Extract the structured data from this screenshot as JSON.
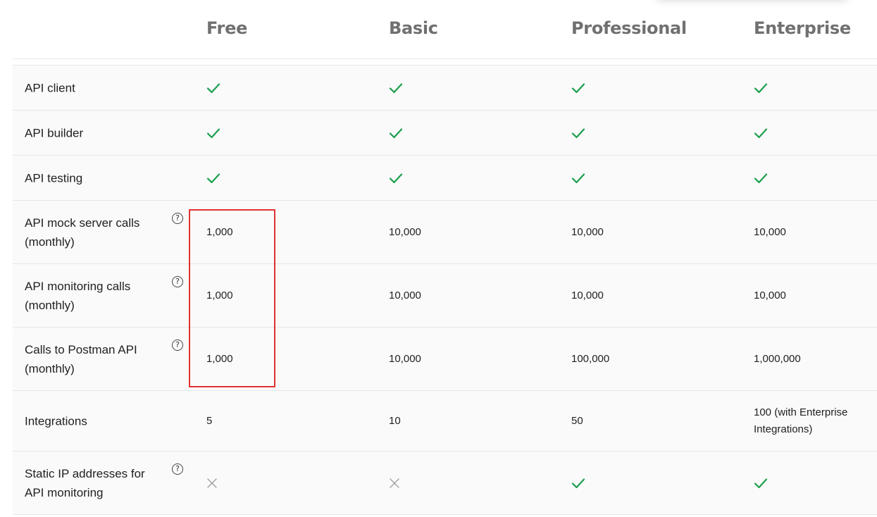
{
  "plans": [
    "Free",
    "Basic",
    "Professional",
    "Enterprise"
  ],
  "rows": [
    {
      "feature": "API client",
      "help": false,
      "values": [
        "check",
        "check",
        "check",
        "check"
      ]
    },
    {
      "feature": "API builder",
      "help": false,
      "values": [
        "check",
        "check",
        "check",
        "check"
      ]
    },
    {
      "feature": "API testing",
      "help": false,
      "values": [
        "check",
        "check",
        "check",
        "check"
      ]
    },
    {
      "feature": "API mock server calls (monthly)",
      "help": true,
      "values": [
        "1,000",
        "10,000",
        "10,000",
        "10,000"
      ]
    },
    {
      "feature": "API monitoring calls (monthly)",
      "help": true,
      "values": [
        "1,000",
        "10,000",
        "10,000",
        "10,000"
      ]
    },
    {
      "feature": "Calls to Postman API (monthly)",
      "help": true,
      "values": [
        "1,000",
        "10,000",
        "100,000",
        "1,000,000"
      ]
    },
    {
      "feature": "Integrations",
      "help": false,
      "values": [
        "5",
        "10",
        "50",
        "100 (with Enterprise Integrations)"
      ]
    },
    {
      "feature": "Static IP addresses for API monitoring",
      "help": true,
      "values": [
        "cross",
        "cross",
        "check",
        "check"
      ]
    }
  ],
  "colors": {
    "check": "#1a9e4b",
    "cross": "#a0a0a0",
    "highlight": "#e03131"
  },
  "icons": {
    "check": "checkmark-icon",
    "cross": "cross-icon",
    "help": "question-circle-icon"
  }
}
